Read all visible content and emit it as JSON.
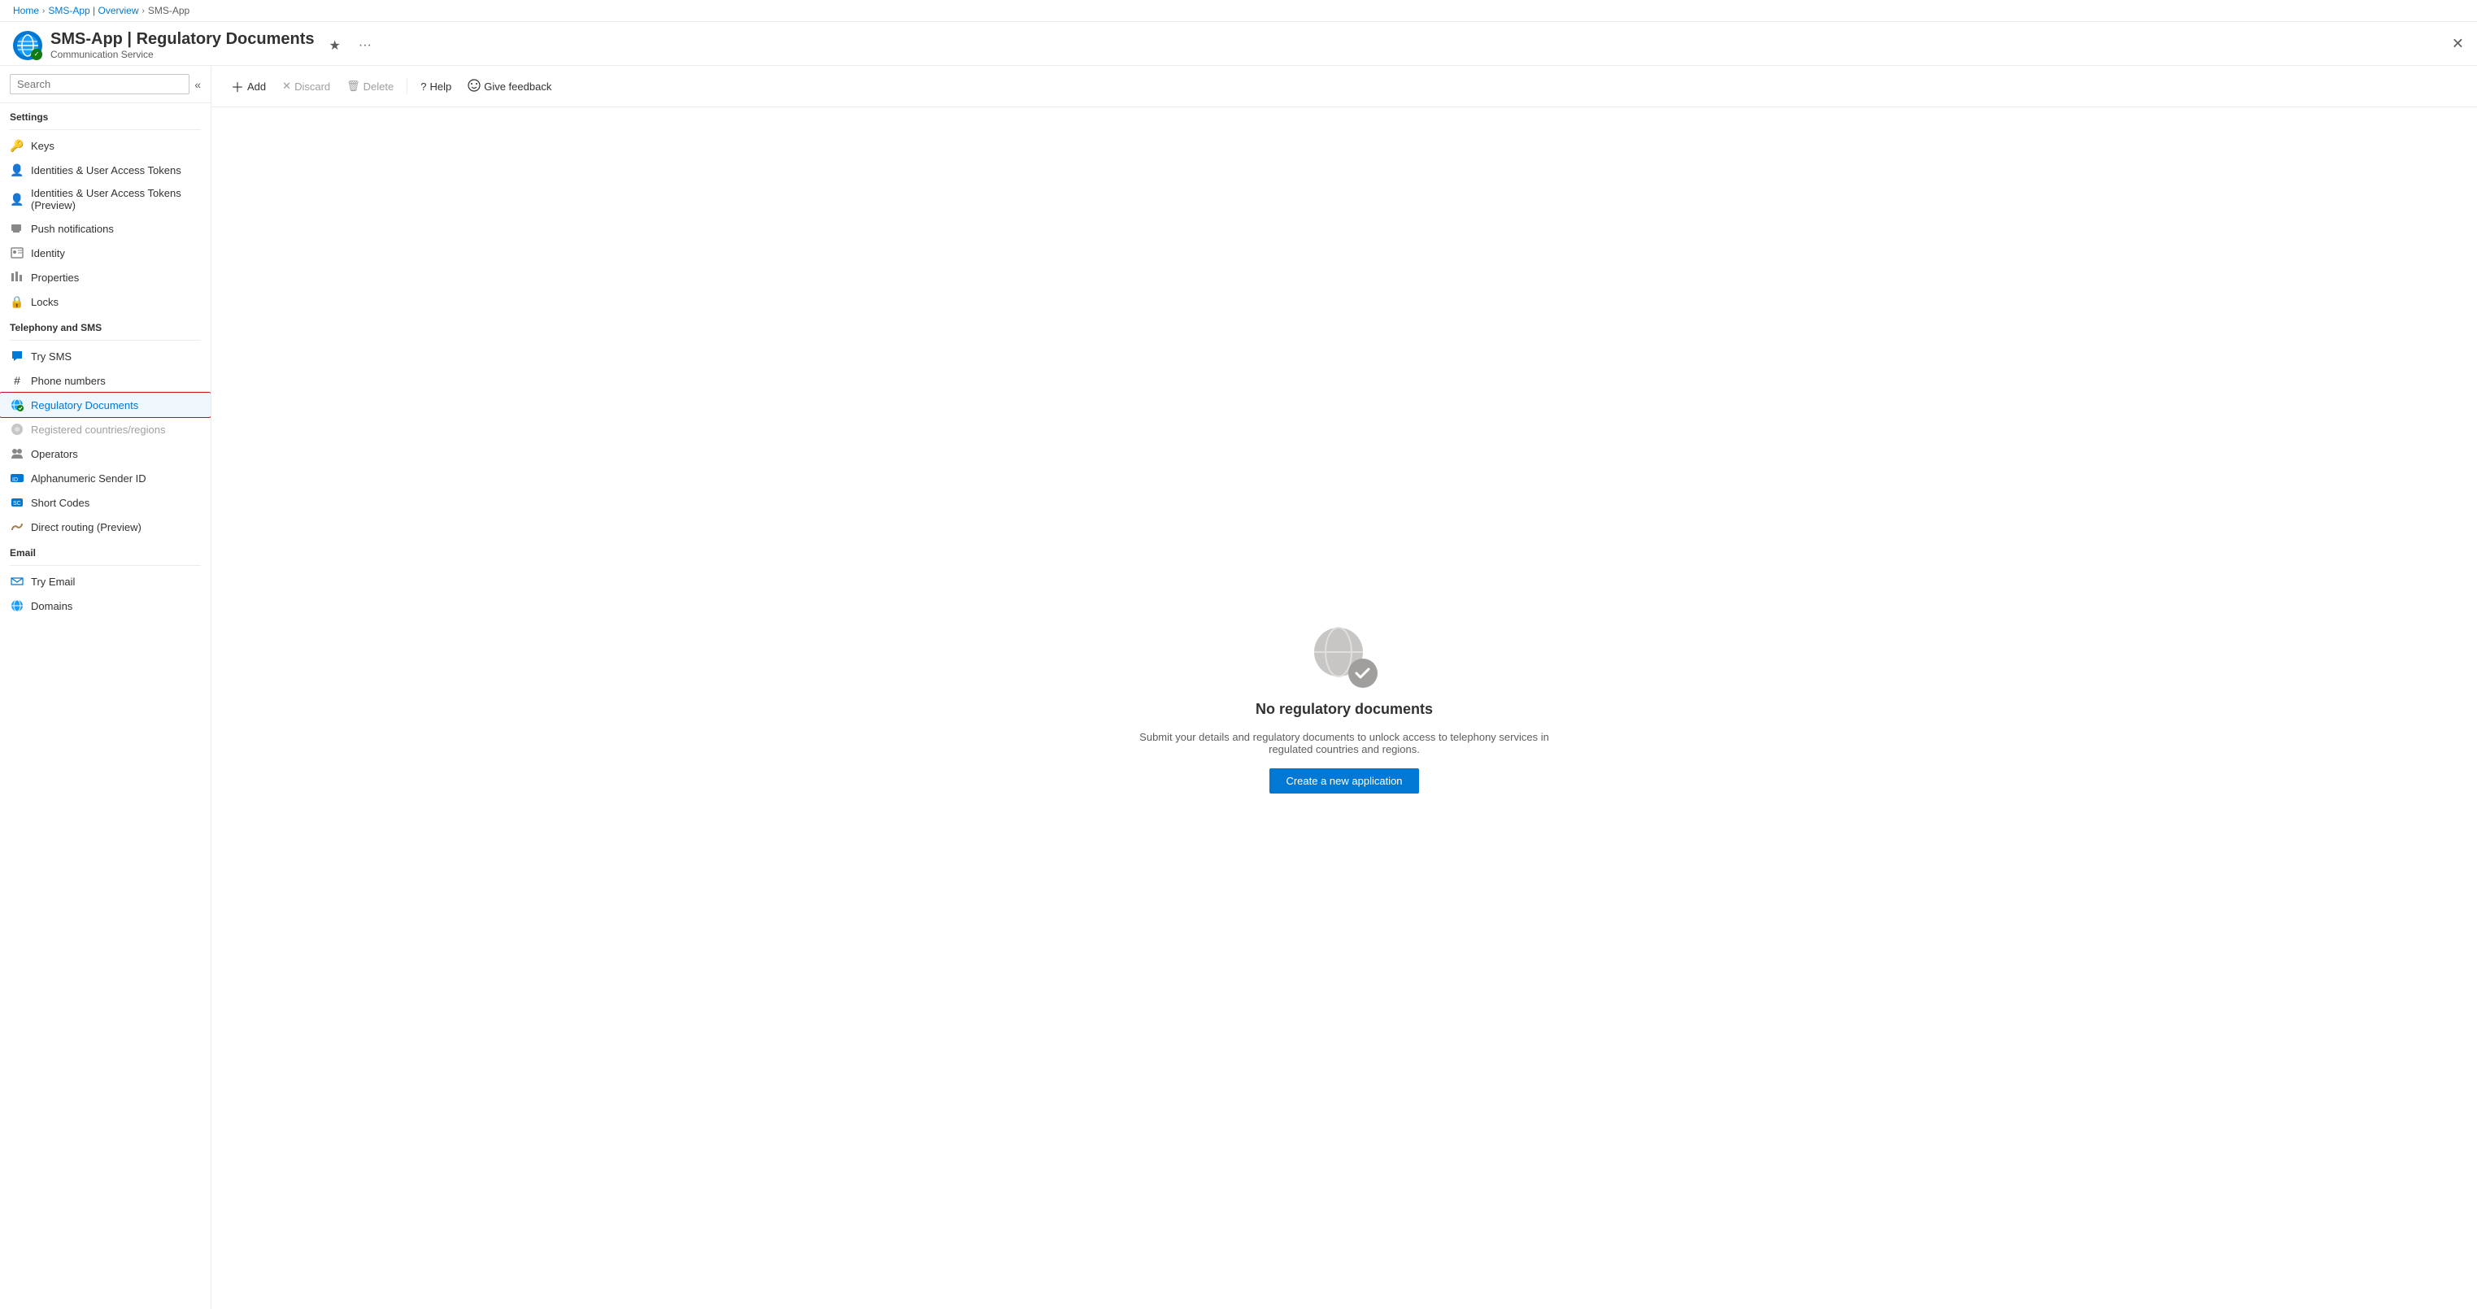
{
  "breadcrumb": {
    "items": [
      {
        "label": "Home",
        "href": "#"
      },
      {
        "label": "SMS-App | Overview",
        "href": "#"
      },
      {
        "label": "SMS-App",
        "href": "#"
      }
    ]
  },
  "header": {
    "title": "SMS-App | Regulatory Documents",
    "subtitle": "Communication Service",
    "star_title": "Favorite",
    "more_title": "More options"
  },
  "sidebar": {
    "search_placeholder": "Search",
    "sections": [
      {
        "label": "Settings",
        "items": [
          {
            "id": "keys",
            "label": "Keys",
            "icon": "key"
          },
          {
            "id": "identities",
            "label": "Identities & User Access Tokens",
            "icon": "person"
          },
          {
            "id": "identities-preview",
            "label": "Identities & User Access Tokens (Preview)",
            "icon": "person"
          },
          {
            "id": "push-notifications",
            "label": "Push notifications",
            "icon": "notification"
          },
          {
            "id": "identity",
            "label": "Identity",
            "icon": "id"
          },
          {
            "id": "properties",
            "label": "Properties",
            "icon": "properties"
          },
          {
            "id": "locks",
            "label": "Locks",
            "icon": "lock"
          }
        ]
      },
      {
        "label": "Telephony and SMS",
        "items": [
          {
            "id": "try-sms",
            "label": "Try SMS",
            "icon": "sms"
          },
          {
            "id": "phone-numbers",
            "label": "Phone numbers",
            "icon": "phone"
          },
          {
            "id": "regulatory-documents",
            "label": "Regulatory Documents",
            "icon": "regulatory",
            "active": true
          },
          {
            "id": "registered-countries",
            "label": "Registered countries/regions",
            "icon": "countries",
            "disabled": true
          },
          {
            "id": "operators",
            "label": "Operators",
            "icon": "operators"
          },
          {
            "id": "alphanumeric",
            "label": "Alphanumeric Sender ID",
            "icon": "alpha"
          },
          {
            "id": "short-codes",
            "label": "Short Codes",
            "icon": "short"
          },
          {
            "id": "direct-routing",
            "label": "Direct routing (Preview)",
            "icon": "routing"
          }
        ]
      },
      {
        "label": "Email",
        "items": [
          {
            "id": "try-email",
            "label": "Try Email",
            "icon": "email"
          },
          {
            "id": "domains",
            "label": "Domains",
            "icon": "domain"
          }
        ]
      }
    ]
  },
  "command_bar": {
    "add_label": "Add",
    "discard_label": "Discard",
    "delete_label": "Delete",
    "help_label": "Help",
    "feedback_label": "Give feedback"
  },
  "content": {
    "empty_title": "No regulatory documents",
    "empty_subtitle": "Submit your details and regulatory documents to unlock access to telephony services in regulated countries and regions.",
    "create_button_label": "Create a new application"
  }
}
